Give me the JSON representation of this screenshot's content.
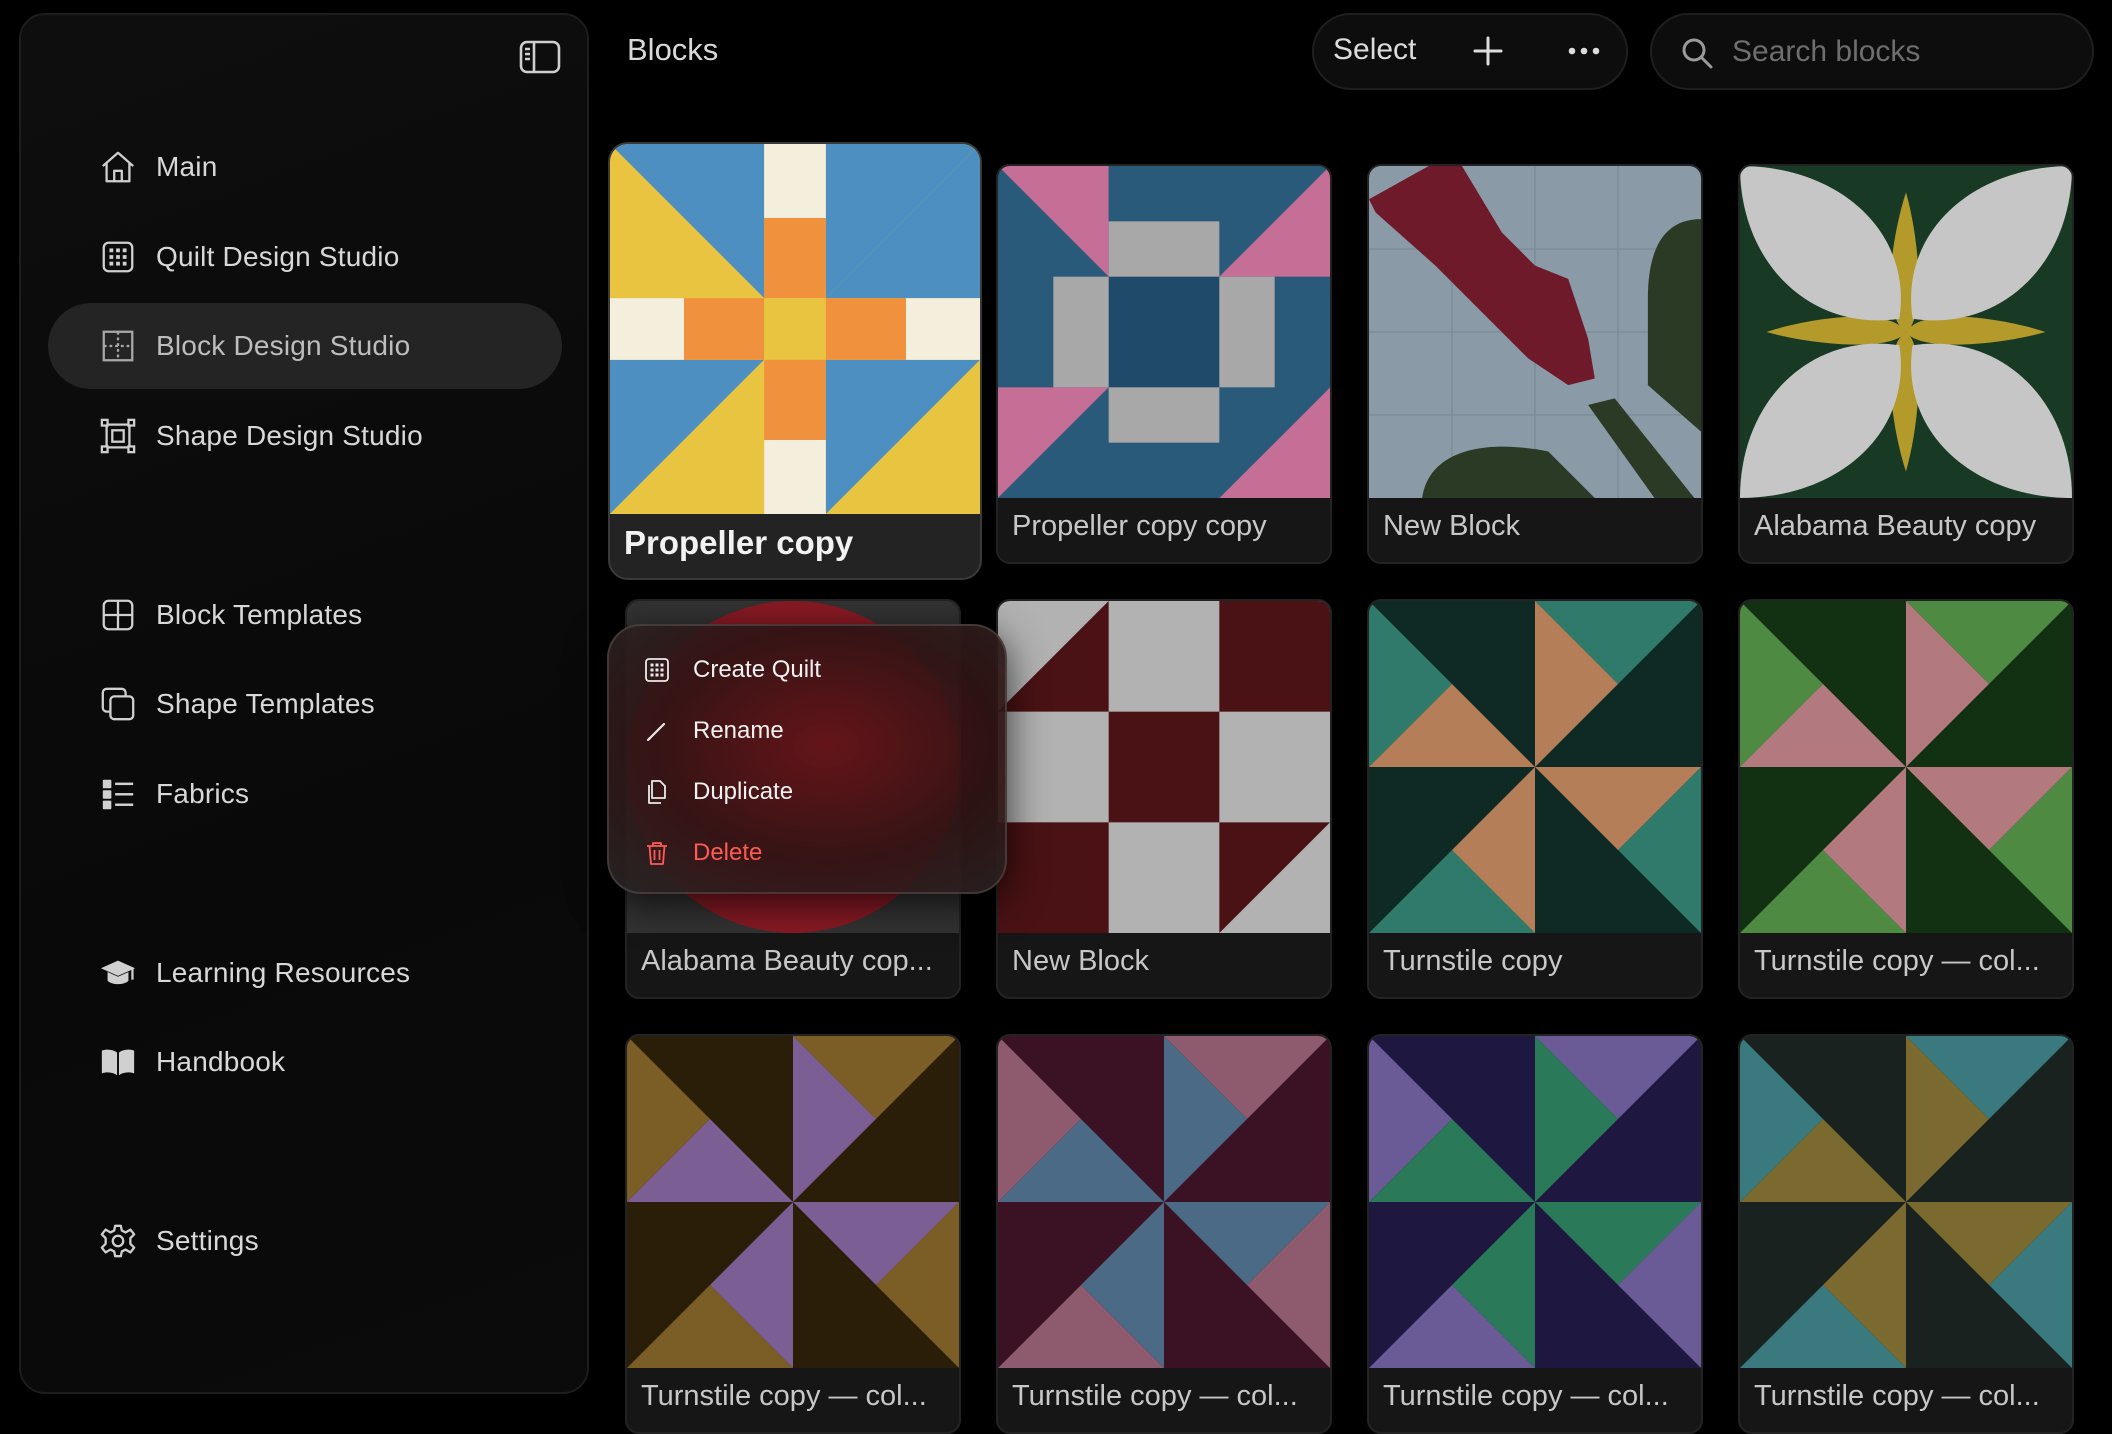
{
  "header": {
    "title": "Blocks"
  },
  "toolbar": {
    "select_label": "Select",
    "plus_icon": "plus-icon",
    "more_icon": "ellipsis-icon"
  },
  "search": {
    "placeholder": "Search blocks",
    "value": ""
  },
  "sidebar": {
    "toggle_icon": "sidebar-toggle-icon",
    "items": [
      {
        "label": "Main",
        "icon": "house-icon"
      },
      {
        "label": "Quilt Design Studio",
        "icon": "grid-icon"
      },
      {
        "label": "Block Design Studio",
        "icon": "block-grid-icon",
        "active": true
      },
      {
        "label": "Shape Design Studio",
        "icon": "shape-frame-icon"
      },
      {
        "label": "Block Templates",
        "icon": "four-square-icon"
      },
      {
        "label": "Shape Templates",
        "icon": "stacked-squares-icon"
      },
      {
        "label": "Fabrics",
        "icon": "list-icon"
      },
      {
        "label": "Learning Resources",
        "icon": "graduation-cap-icon"
      },
      {
        "label": "Handbook",
        "icon": "book-icon"
      },
      {
        "label": "Settings",
        "icon": "gear-icon"
      }
    ]
  },
  "blocks": [
    {
      "name": "Propeller copy",
      "colors": {
        "bg": "#e8c441",
        "accent": "#4d8fc0",
        "center": "#f0913d",
        "light": "#f4eedc"
      }
    },
    {
      "name": "Propeller copy copy",
      "colors": {
        "bg": "#2a5a7a",
        "accent": "#c66f96",
        "center": "#a8a8a8",
        "dark": "#1f4a6a"
      }
    },
    {
      "name": "New Block",
      "colors": {
        "bg": "#8a9aa6",
        "flower": "#6e1a2a",
        "leaf": "#2a3a24"
      }
    },
    {
      "name": "Alabama Beauty copy",
      "colors": {
        "bg": "#183a25",
        "petal": "#c6c6c6",
        "star": "#b39a2a"
      }
    },
    {
      "name": "Alabama  Beauty cop...",
      "colors": {
        "bg": "#333333",
        "circle": "#8a1a24"
      }
    },
    {
      "name": "New Block",
      "colors": {
        "dark": "#4a1214",
        "light": "#b2b2b2"
      }
    },
    {
      "name": "Turnstile copy",
      "colors": {
        "bg": "#0f2a24",
        "a": "#2f7a6a",
        "b": "#b37e58"
      }
    },
    {
      "name": "Turnstile copy — col...",
      "colors": {
        "bg": "#123012",
        "a": "#4e8a42",
        "b": "#b27a7e"
      }
    },
    {
      "name": "Turnstile copy — col...",
      "colors": {
        "bg": "#2a1e08",
        "a": "#7a5e26",
        "b": "#7a5e94"
      }
    },
    {
      "name": "Turnstile copy — col...",
      "colors": {
        "bg": "#3a1224",
        "a": "#8e5a6e",
        "b": "#4a6a86"
      }
    },
    {
      "name": "Turnstile copy — col...",
      "colors": {
        "bg": "#1e1840",
        "a": "#6a5a96",
        "b": "#2a7a5a"
      }
    },
    {
      "name": "Turnstile copy — col...",
      "colors": {
        "bg": "#1a2220",
        "a": "#7a6a30",
        "b": "#3a7a7e"
      }
    }
  ],
  "context_menu": {
    "items": [
      {
        "label": "Create Quilt",
        "icon": "grid-icon"
      },
      {
        "label": "Rename",
        "icon": "pencil-icon"
      },
      {
        "label": "Duplicate",
        "icon": "duplicate-icon"
      },
      {
        "label": "Delete",
        "icon": "trash-icon",
        "danger": true
      }
    ]
  }
}
